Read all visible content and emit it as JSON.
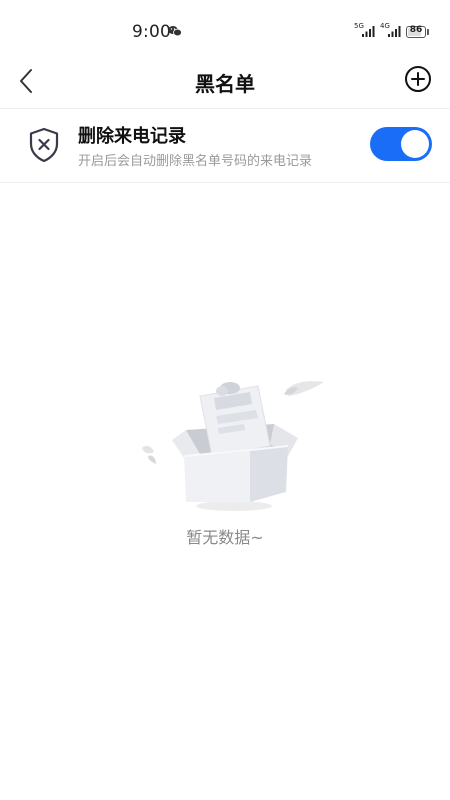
{
  "status_bar": {
    "time": "9:00",
    "signal_1_label": "5G",
    "signal_2_label": "4G",
    "battery_level": "86",
    "battery_percent": 86
  },
  "header": {
    "title": "黑名单",
    "back_icon": "chevron-left-icon",
    "add_icon": "plus-circle-icon"
  },
  "setting": {
    "title": "删除来电记录",
    "description": "开启后会自动删除黑名单号码的来电记录",
    "enabled": true,
    "icon": "shield-x-icon"
  },
  "empty_state": {
    "message": "暂无数据~",
    "icon": "empty-box-icon"
  },
  "colors": {
    "accent": "#1a6df6",
    "text_primary": "#111111",
    "text_secondary": "#9a9a9a",
    "divider": "#eeeeee"
  }
}
